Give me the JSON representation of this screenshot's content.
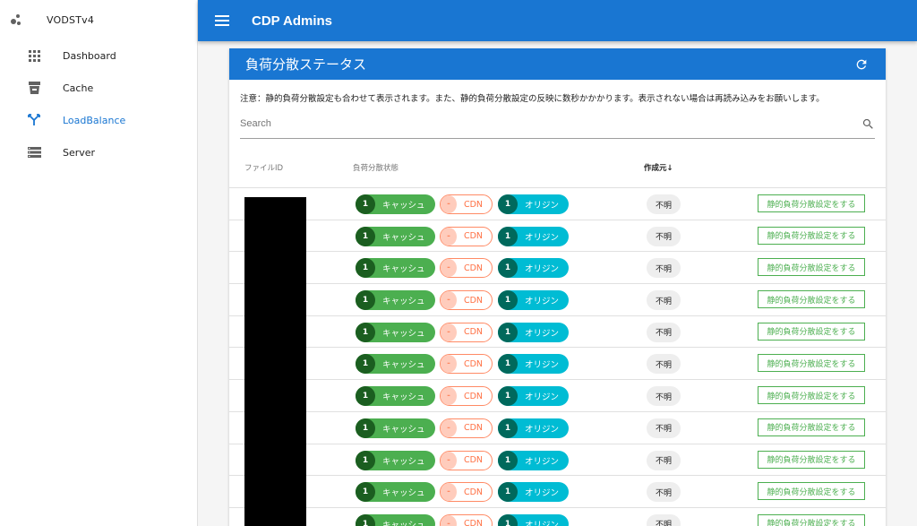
{
  "brand": {
    "title": "VODSTv4"
  },
  "sidebar": {
    "items": [
      {
        "label": "Dashboard",
        "icon": "grid-icon"
      },
      {
        "label": "Cache",
        "icon": "cache-icon"
      },
      {
        "label": "LoadBalance",
        "icon": "call-split-icon",
        "active": true
      },
      {
        "label": "Server",
        "icon": "server-icon"
      }
    ]
  },
  "appbar": {
    "title": "CDP Admins"
  },
  "card": {
    "title": "負荷分散ステータス",
    "notice": "注意：静的負荷分散設定も合わせて表示されます。また、静的負荷分散設定の反映に数秒かかかります。表示されない場合は再読み込みをお願いします。",
    "search_placeholder": "Search"
  },
  "table": {
    "headers": {
      "file_id": "ファイルID",
      "status": "負荷分散状態",
      "created": "作成元",
      "sort_arrow": "↓"
    },
    "rows": [
      {
        "cache_count": "1",
        "cache_label": "キャッシュ",
        "cdn_count": "-",
        "cdn_label": "CDN",
        "origin_count": "1",
        "origin_label": "オリジン",
        "creator": "不明",
        "action": "静的負荷分散設定をする"
      },
      {
        "cache_count": "1",
        "cache_label": "キャッシュ",
        "cdn_count": "-",
        "cdn_label": "CDN",
        "origin_count": "1",
        "origin_label": "オリジン",
        "creator": "不明",
        "action": "静的負荷分散設定をする"
      },
      {
        "cache_count": "1",
        "cache_label": "キャッシュ",
        "cdn_count": "-",
        "cdn_label": "CDN",
        "origin_count": "1",
        "origin_label": "オリジン",
        "creator": "不明",
        "action": "静的負荷分散設定をする"
      },
      {
        "cache_count": "1",
        "cache_label": "キャッシュ",
        "cdn_count": "-",
        "cdn_label": "CDN",
        "origin_count": "1",
        "origin_label": "オリジン",
        "creator": "不明",
        "action": "静的負荷分散設定をする"
      },
      {
        "cache_count": "1",
        "cache_label": "キャッシュ",
        "cdn_count": "-",
        "cdn_label": "CDN",
        "origin_count": "1",
        "origin_label": "オリジン",
        "creator": "不明",
        "action": "静的負荷分散設定をする"
      },
      {
        "cache_count": "1",
        "cache_label": "キャッシュ",
        "cdn_count": "-",
        "cdn_label": "CDN",
        "origin_count": "1",
        "origin_label": "オリジン",
        "creator": "不明",
        "action": "静的負荷分散設定をする"
      },
      {
        "cache_count": "1",
        "cache_label": "キャッシュ",
        "cdn_count": "-",
        "cdn_label": "CDN",
        "origin_count": "1",
        "origin_label": "オリジン",
        "creator": "不明",
        "action": "静的負荷分散設定をする"
      },
      {
        "cache_count": "1",
        "cache_label": "キャッシュ",
        "cdn_count": "-",
        "cdn_label": "CDN",
        "origin_count": "1",
        "origin_label": "オリジン",
        "creator": "不明",
        "action": "静的負荷分散設定をする"
      },
      {
        "cache_count": "1",
        "cache_label": "キャッシュ",
        "cdn_count": "-",
        "cdn_label": "CDN",
        "origin_count": "1",
        "origin_label": "オリジン",
        "creator": "不明",
        "action": "静的負荷分散設定をする"
      },
      {
        "cache_count": "1",
        "cache_label": "キャッシュ",
        "cdn_count": "-",
        "cdn_label": "CDN",
        "origin_count": "1",
        "origin_label": "オリジン",
        "creator": "不明",
        "action": "静的負荷分散設定をする"
      },
      {
        "cache_count": "1",
        "cache_label": "キャッシュ",
        "cdn_count": "-",
        "cdn_label": "CDN",
        "origin_count": "1",
        "origin_label": "オリジン",
        "creator": "不明",
        "action": "静的負荷分散設定をする"
      }
    ]
  },
  "colors": {
    "primary": "#1976d2",
    "cache": "#4caf50",
    "cache_dark": "#1b5e20",
    "cdn": "#ff8a65",
    "origin": "#00bcd4",
    "origin_dark": "#00695c",
    "redaction": "#000000"
  }
}
